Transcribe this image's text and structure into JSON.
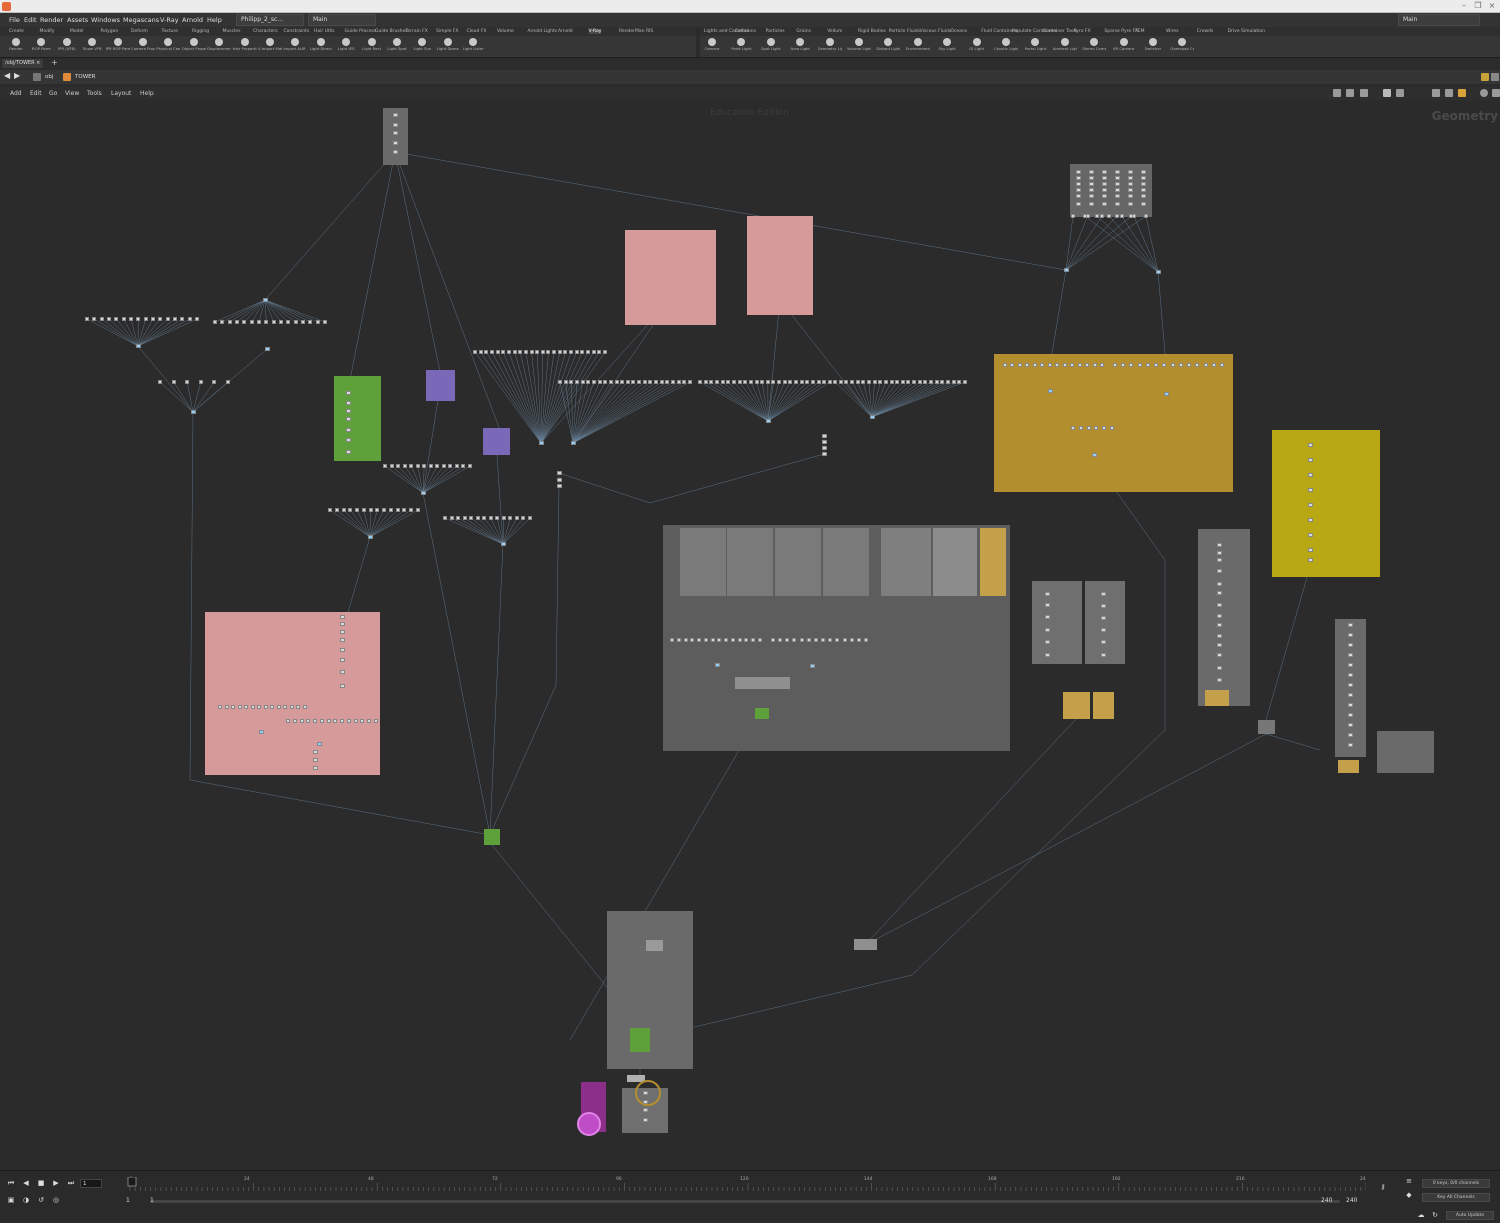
{
  "window": {
    "controls": [
      "–",
      "❐",
      "×"
    ]
  },
  "menubar": {
    "items": [
      "File",
      "Edit",
      "Render",
      "Assets",
      "Windows",
      "Megascans",
      "V-Ray",
      "Arnold",
      "Help"
    ],
    "scene_file": "Philipp_2_sc...",
    "desktop": "Main",
    "right_desktop": "Main"
  },
  "shelf_left": {
    "tabs": [
      "Create",
      "Modify",
      "Model",
      "Polygon",
      "Deform",
      "Texture",
      "Rigging",
      "Muscles",
      "Characters",
      "Constraints",
      "Hair Utils",
      "Guide Process",
      "Guide Brushes",
      "Terrain FX",
      "Simple FX",
      "Cloud FX",
      "Volume",
      "Arnold Lights",
      "Arnold",
      "V-Ray",
      "RenderMan RIS"
    ],
    "active_tab": "V-Ray",
    "tools": [
      "Render",
      "ROP Parm",
      "IPR (VFB)",
      "Show VFB",
      "IPR ROP Parm",
      "Camera Properties",
      "Physical Camera",
      "Object Properties",
      "Displacement Properties",
      "Hair Properties",
      "V-Import Material",
      "Import ALIR Cache",
      "Light Direct",
      "Light IES",
      "Light Rect",
      "Light Spot",
      "Light Sun",
      "Light Dome",
      "Light Lister"
    ]
  },
  "shelf_right": {
    "tabs": [
      "Lights and Cameras",
      "Collisions",
      "Particles",
      "Grains",
      "Vellum",
      "Rigid Bodies",
      "Particle Fluids",
      "Viscous Fluids",
      "Oceans",
      "Fluid Containers",
      "Populate Containers",
      "Container Tools",
      "Pyro FX",
      "Sparse Pyro FX",
      "FEM",
      "Wires",
      "Crowds",
      "Drive Simulation"
    ],
    "tools": [
      "Camera",
      "Point Light",
      "Spot Light",
      "Area Light",
      "Geometry Light",
      "Volume Light",
      "Distant Light",
      "Environment Light",
      "Sky Light",
      "GI Light",
      "Caustic Light",
      "Portal Light",
      "Ambient Light",
      "Stereo Camera",
      "VR Camera",
      "Switcher",
      "Gamepad Camera"
    ]
  },
  "path_tab": "/obj/TOWER",
  "path": [
    "obj",
    "TOWER"
  ],
  "network_menu": [
    "Add",
    "Edit",
    "Go",
    "View",
    "Tools",
    "Layout",
    "Help"
  ],
  "network": {
    "watermark": "Education Edition",
    "context_label": "Geometry"
  },
  "timeline": {
    "current_frame": "1",
    "ticks": [
      "1",
      "24",
      "48",
      "72",
      "96",
      "120",
      "144",
      "168",
      "192",
      "216",
      "24"
    ],
    "range_start": "1",
    "range_start_2": "1",
    "range_end": "240",
    "range_end_2": "240",
    "keys_info": "0 keys, 0/0 channels",
    "key_all": "Key All Channels",
    "auto_update": "Auto Update"
  }
}
